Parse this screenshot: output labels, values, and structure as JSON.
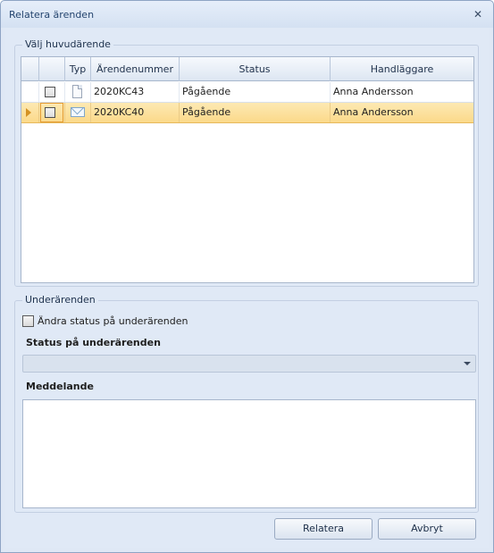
{
  "window": {
    "title": "Relatera ärenden",
    "close_glyph": "✕"
  },
  "main_group": {
    "caption": "Välj huvudärende",
    "grid": {
      "columns": [
        "",
        "",
        "Typ",
        "Ärendenummer",
        "Status",
        "Handläggare"
      ],
      "rows": [
        {
          "type_icon": "document-icon",
          "case_number": "2020KC43",
          "status": "Pågående",
          "handler": "Anna Andersson",
          "selected": false,
          "checked": false
        },
        {
          "type_icon": "mail-icon",
          "case_number": "2020KC40",
          "status": "Pågående",
          "handler": "Anna Andersson",
          "selected": true,
          "checked": false
        }
      ]
    }
  },
  "sub_group": {
    "caption": "Underärenden",
    "change_status_checkbox": {
      "label": "Ändra status på underärenden",
      "checked": false
    },
    "status_label": "Status på underärenden",
    "status_value": "",
    "message_label": "Meddelande",
    "message_value": ""
  },
  "buttons": {
    "relate": "Relatera",
    "cancel": "Avbryt"
  },
  "colors": {
    "selection": "#fbd98a",
    "window_bg": "#e0e9f6",
    "title_text": "#24446e"
  }
}
